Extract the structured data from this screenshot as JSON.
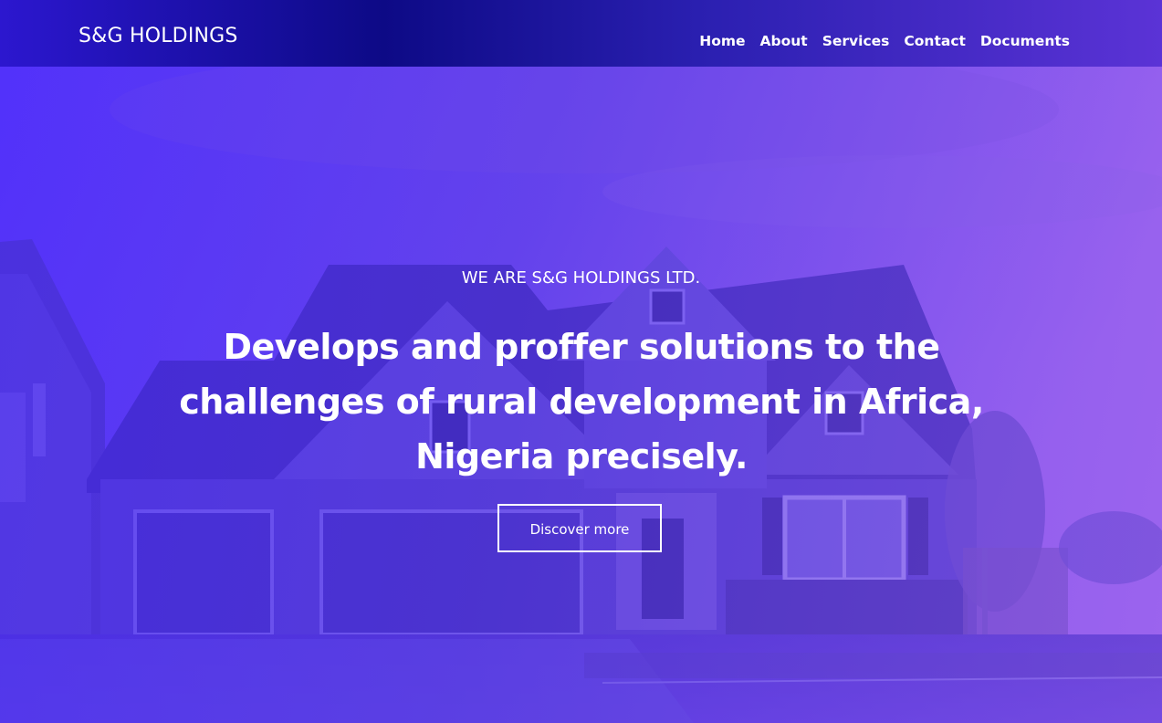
{
  "brand": {
    "name": "S&G HOLDINGS"
  },
  "nav": {
    "items": [
      {
        "label": "Home"
      },
      {
        "label": "About"
      },
      {
        "label": "Services"
      },
      {
        "label": "Contact"
      },
      {
        "label": "Documents"
      }
    ]
  },
  "hero": {
    "eyebrow": "WE ARE S&G HOLDINGS LTD.",
    "headline": "Develops and proffer solutions to the challenges of rural development in Africa, Nigeria precisely.",
    "cta_label": "Discover more",
    "background_image": "house-photo"
  },
  "colors": {
    "header_left": "#2c17cf",
    "header_mid": "#0d0a86",
    "header_right": "#5b33d6",
    "overlay_blue": "#4a28ff",
    "overlay_violet": "#965aeb",
    "text": "#ffffff"
  }
}
